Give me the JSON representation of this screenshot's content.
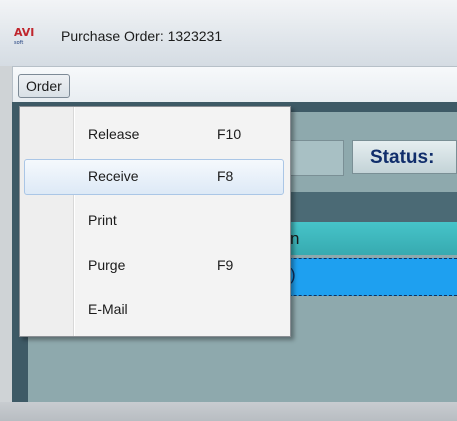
{
  "window": {
    "logo_text": "AVI",
    "logo_sub": "soft",
    "title": "Purchase Order: 1323231"
  },
  "menubar": {
    "order_label": "Order"
  },
  "main": {
    "status_label": "Status:",
    "column_header_fragment": "n",
    "selected_row_fragment": ")"
  },
  "order_menu": {
    "items": [
      {
        "label": "Release",
        "shortcut": "F10",
        "highlighted": false
      },
      {
        "label": "Receive",
        "shortcut": "F8",
        "highlighted": true
      },
      {
        "label": "Print",
        "shortcut": "",
        "highlighted": false
      },
      {
        "label": "Purge",
        "shortcut": "F9",
        "highlighted": false
      },
      {
        "label": "E-Mail",
        "shortcut": "",
        "highlighted": false
      }
    ]
  },
  "colors": {
    "header_teal": "#3cb6bc",
    "selection_blue": "#1ea0f0",
    "status_text": "#112e6b",
    "menu_hover": "#dde9f6"
  }
}
